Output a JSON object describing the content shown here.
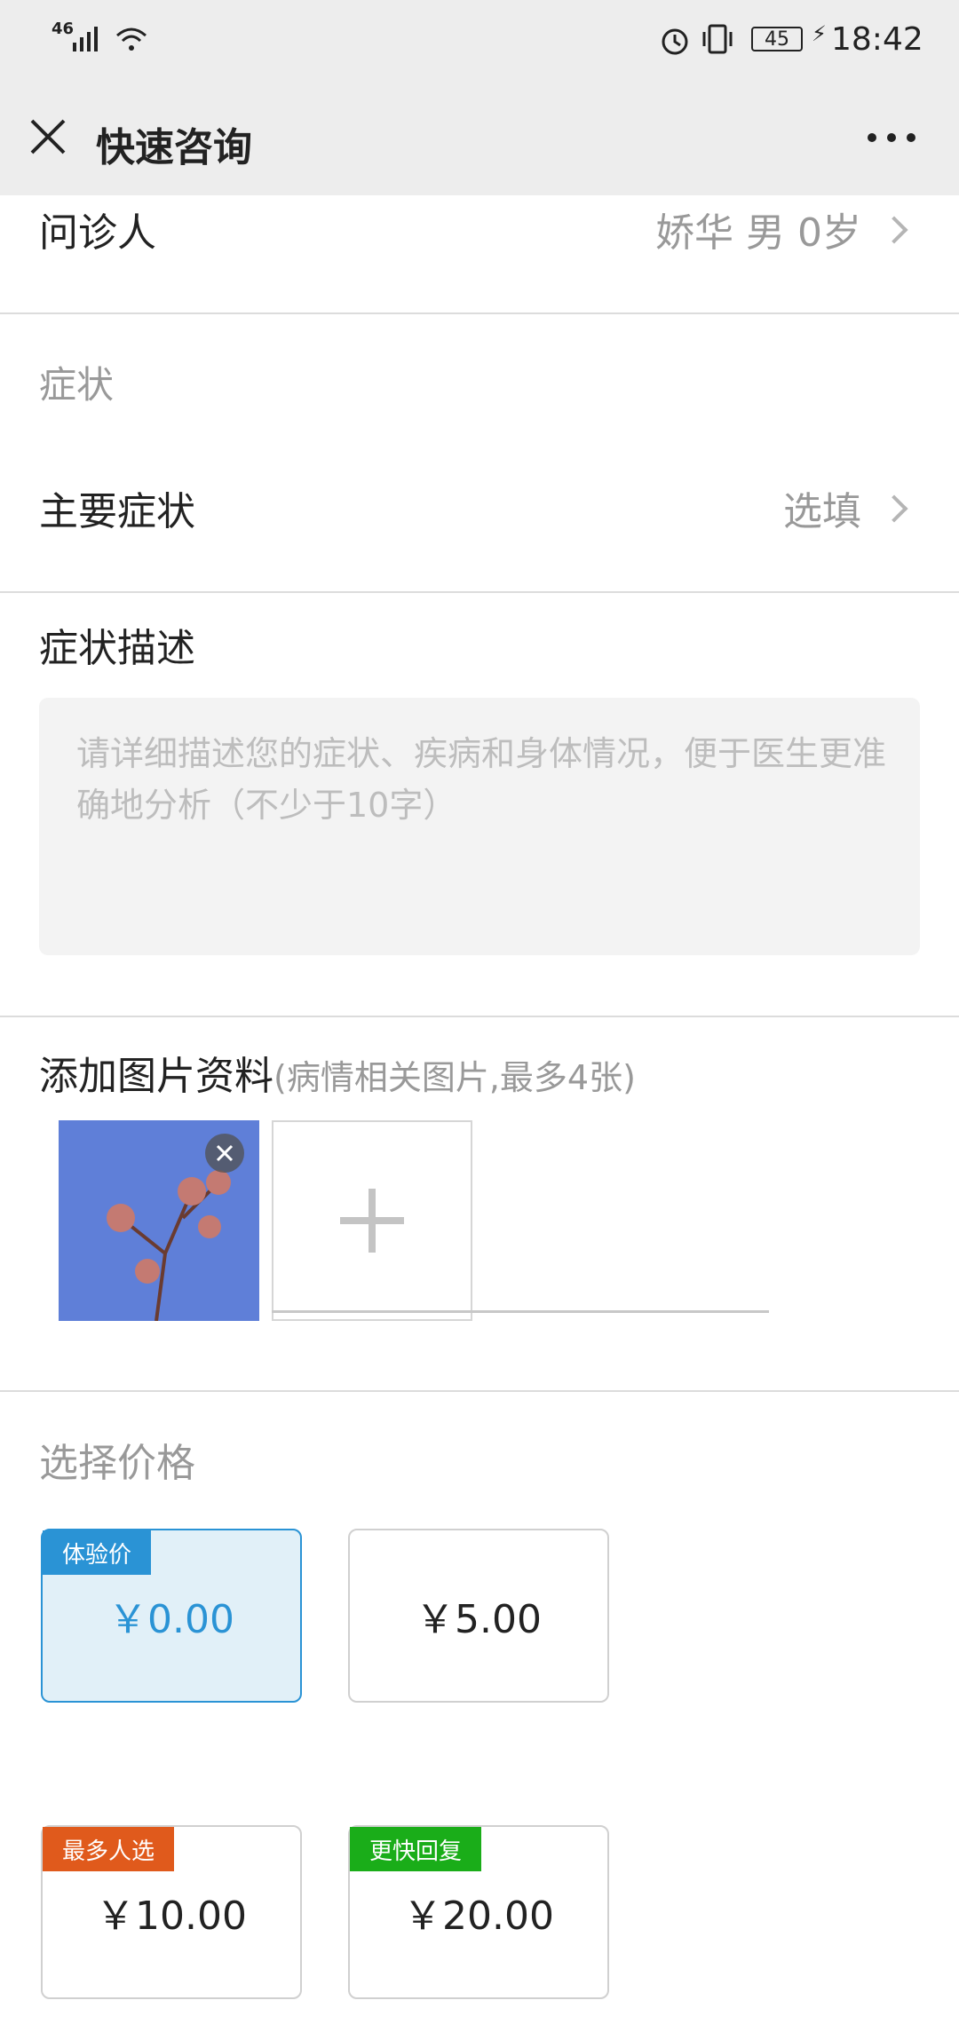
{
  "status": {
    "network": "46",
    "battery": "45",
    "time": "18:42"
  },
  "nav": {
    "title": "快速咨询"
  },
  "patient": {
    "label": "问诊人",
    "value": "娇华 男 0岁"
  },
  "symptoms": {
    "section": "症状",
    "main_label": "主要症状",
    "main_value": "选填",
    "desc_label": "症状描述",
    "placeholder": "请详细描述您的症状、疾病和身体情况，便于医生更准确地分析（不少于10字）"
  },
  "photos": {
    "label": "添加图片资料",
    "hint": "(病情相关图片,最多4张)"
  },
  "pricing": {
    "label": "选择价格",
    "options": [
      {
        "badge": "体验价",
        "price": "￥0.00",
        "selected": true,
        "badge_color": "#2a93d5"
      },
      {
        "badge": "",
        "price": "￥5.00",
        "selected": false
      },
      {
        "badge": "最多人选",
        "price": "￥10.00",
        "selected": false,
        "badge_color": "#e05a1c"
      },
      {
        "badge": "更快回复",
        "price": "￥20.00",
        "selected": false,
        "badge_color": "#1aad19"
      }
    ]
  },
  "colors": {
    "accent": "#2a93d5",
    "selected_bg": "#e1f0f8"
  }
}
